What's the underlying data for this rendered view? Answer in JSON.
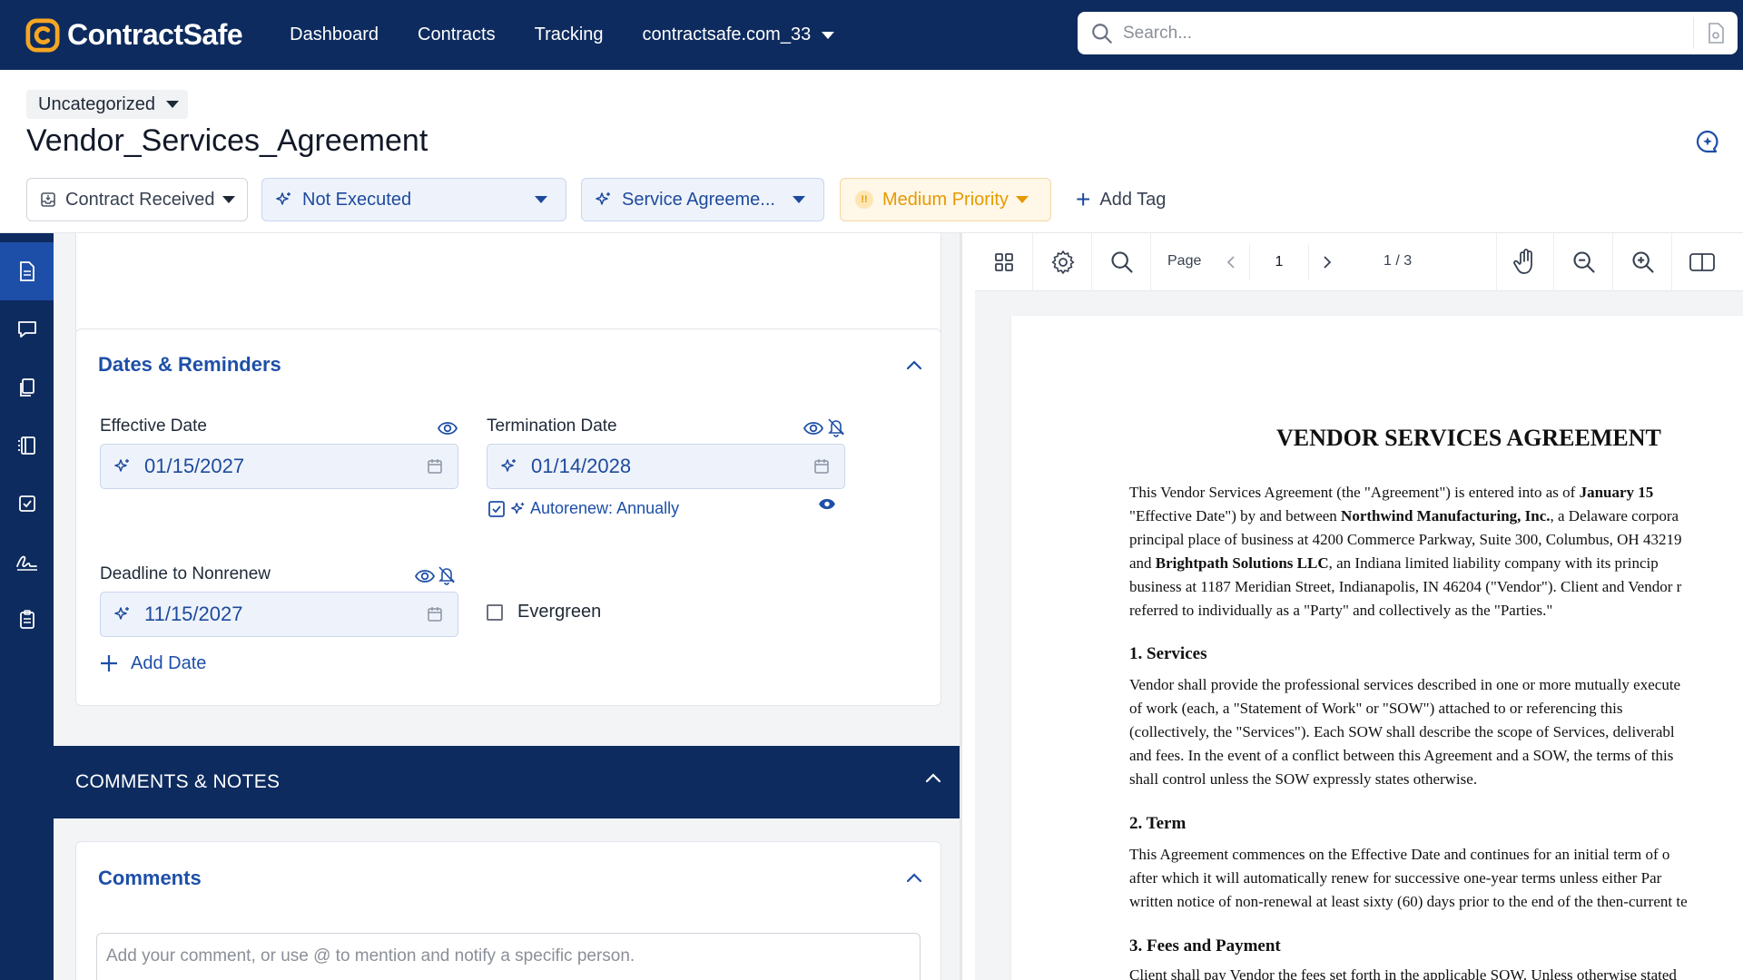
{
  "app": {
    "brand": "ContractSafe",
    "colors": {
      "navy": "#0d2b5e",
      "accent": "#1e4fa8",
      "priority": "#e59a00"
    }
  },
  "nav": {
    "dashboard": "Dashboard",
    "contracts": "Contracts",
    "tracking": "Tracking",
    "account": "contractsafe.com_33"
  },
  "search": {
    "placeholder": "Search..."
  },
  "header": {
    "category": "Uncategorized",
    "title": "Vendor_Services_Agreement",
    "status_chips": {
      "received": "Contract Received",
      "execution": "Not Executed",
      "type": "Service Agreeme...",
      "priority": "Medium Priority",
      "priority_glyph": "!!",
      "add_tag": "Add Tag"
    }
  },
  "rail": {
    "items": [
      "document-icon",
      "comment-icon",
      "copy-icon",
      "book-icon",
      "checkbox-icon",
      "signature-icon",
      "clipboard-icon"
    ],
    "active": "document-icon"
  },
  "dates_section": {
    "title": "Dates & Reminders",
    "effective": {
      "label": "Effective Date",
      "value": "01/15/2027"
    },
    "termination": {
      "label": "Termination Date",
      "value": "01/14/2028"
    },
    "autorenew": {
      "label": "Autorenew: Annually",
      "checked": true
    },
    "nonrenew": {
      "label": "Deadline to Nonrenew",
      "value": "11/15/2027"
    },
    "evergreen": {
      "label": "Evergreen",
      "checked": false
    },
    "add_date": "Add Date"
  },
  "comments_band": {
    "title": "COMMENTS & NOTES"
  },
  "comments": {
    "title": "Comments",
    "placeholder": "Add your comment, or use @ to mention and notify a specific person."
  },
  "viewer": {
    "page_label": "Page",
    "page_value": "1",
    "page_count": "1 / 3"
  },
  "document": {
    "title": "VENDOR SERVICES AGREEMENT",
    "intro_lines": [
      "This Vendor Services Agreement (the \"Agreement\") is entered into as of January 15",
      "\"Effective Date\") by and between Northwind Manufacturing, Inc., a Delaware corpora",
      "principal place of business at 4200 Commerce Parkway, Suite 300, Columbus, OH 43219",
      "and Brightpath Solutions LLC, an Indiana limited liability company with its princip",
      "business at 1187 Meridian Street, Indianapolis, IN 46204 (\"Vendor\"). Client and Vendor r",
      "referred to individually as a \"Party\" and collectively as the \"Parties.\""
    ],
    "s1_heading": "1. Services",
    "s1_lines": [
      "Vendor shall provide the professional services described in one or more mutually execute",
      "of work (each, a \"Statement of Work\" or \"SOW\") attached to or referencing this",
      "(collectively, the \"Services\"). Each SOW shall describe the scope of Services, deliverabl",
      "and fees. In the event of a conflict between this Agreement and a SOW, the terms of this",
      "shall control unless the SOW expressly states otherwise."
    ],
    "s2_heading": "2. Term",
    "s2_lines": [
      "This Agreement commences on the Effective Date and continues for an initial term of o",
      "after which it will automatically renew for successive one-year terms unless either Par",
      "written notice of non-renewal at least sixty (60) days prior to the end of the then-current te"
    ],
    "s3_heading": "3. Fees and Payment",
    "s3_lines": [
      "Client shall pay Vendor the fees set forth in the applicable SOW. Unless otherwise stated"
    ]
  }
}
